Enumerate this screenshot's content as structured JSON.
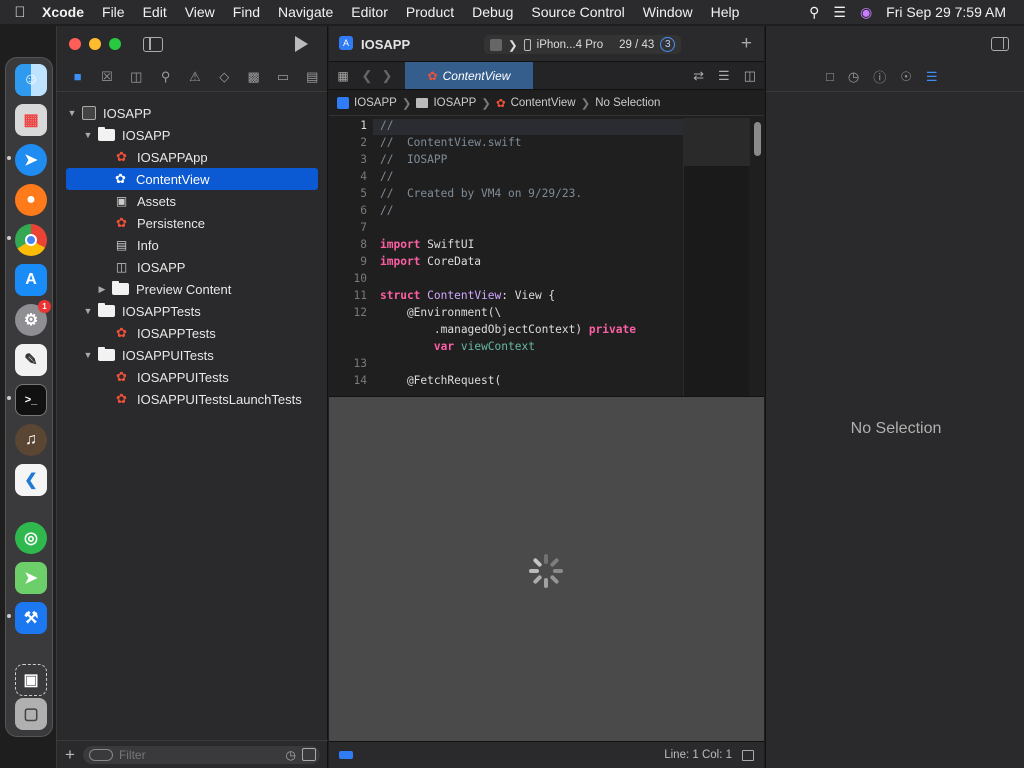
{
  "menubar": {
    "app": "Xcode",
    "items": [
      "File",
      "Edit",
      "View",
      "Find",
      "Navigate",
      "Editor",
      "Product",
      "Debug",
      "Source Control",
      "Window",
      "Help"
    ],
    "datetime": "Fri Sep 29  7:59 AM",
    "icons": [
      "search-icon",
      "control-center-icon",
      "siri-icon"
    ]
  },
  "dock": {
    "items": [
      "finder",
      "launchpad",
      "safari",
      "firefox",
      "chrome",
      "app-store",
      "system-settings",
      "textedit",
      "terminal",
      "instruments",
      "vscode",
      "find-my",
      "maps",
      "xcode",
      "screenshot",
      "trash"
    ],
    "settings_badge": "1"
  },
  "toolbar": {
    "project": "IOSAPP",
    "scheme": "iPhon...4 Pro",
    "count": "29 / 43",
    "issues": "3"
  },
  "navigator": {
    "tree": [
      {
        "label": "IOSAPP",
        "level": 0,
        "icon": "project",
        "disclosure": "open"
      },
      {
        "label": "IOSAPP",
        "level": 1,
        "icon": "folder",
        "disclosure": "open"
      },
      {
        "label": "IOSAPPApp",
        "level": 2,
        "icon": "swift"
      },
      {
        "label": "ContentView",
        "level": 2,
        "icon": "swift",
        "selected": true
      },
      {
        "label": "Assets",
        "level": 2,
        "icon": "assets"
      },
      {
        "label": "Persistence",
        "level": 2,
        "icon": "swift"
      },
      {
        "label": "Info",
        "level": 2,
        "icon": "plist"
      },
      {
        "label": "IOSAPP",
        "level": 2,
        "icon": "datamodel"
      },
      {
        "label": "Preview Content",
        "level": 2,
        "icon": "folder",
        "disclosure": "closed"
      },
      {
        "label": "IOSAPPTests",
        "level": 1,
        "icon": "folder",
        "disclosure": "open"
      },
      {
        "label": "IOSAPPTests",
        "level": 2,
        "icon": "swift"
      },
      {
        "label": "IOSAPPUITests",
        "level": 1,
        "icon": "folder",
        "disclosure": "open"
      },
      {
        "label": "IOSAPPUITests",
        "level": 2,
        "icon": "swift"
      },
      {
        "label": "IOSAPPUITestsLaunchTests",
        "level": 2,
        "icon": "swift"
      }
    ],
    "filter_placeholder": "Filter"
  },
  "editor": {
    "tab": "ContentView",
    "jumpbar": [
      "IOSAPP",
      "IOSAPP",
      "ContentView",
      "No Selection"
    ],
    "code": [
      {
        "n": "1",
        "t": [
          [
            "cm",
            "//"
          ]
        ]
      },
      {
        "n": "2",
        "t": [
          [
            "cm",
            "//  ContentView.swift"
          ]
        ]
      },
      {
        "n": "3",
        "t": [
          [
            "cm",
            "//  IOSAPP"
          ]
        ]
      },
      {
        "n": "4",
        "t": [
          [
            "cm",
            "//"
          ]
        ]
      },
      {
        "n": "5",
        "t": [
          [
            "cm",
            "//  Created by VM4 on 9/29/23."
          ]
        ]
      },
      {
        "n": "6",
        "t": [
          [
            "cm",
            "//"
          ]
        ]
      },
      {
        "n": "7",
        "t": []
      },
      {
        "n": "8",
        "t": [
          [
            "kw",
            "import"
          ],
          [
            "",
            " SwiftUI"
          ]
        ]
      },
      {
        "n": "9",
        "t": [
          [
            "kw",
            "import"
          ],
          [
            "",
            " CoreData"
          ]
        ]
      },
      {
        "n": "10",
        "t": []
      },
      {
        "n": "11",
        "t": [
          [
            "kw",
            "struct"
          ],
          [
            "",
            " "
          ],
          [
            "ty",
            "ContentView"
          ],
          [
            "",
            ": View {"
          ]
        ]
      },
      {
        "n": "12",
        "t": [
          [
            "",
            "    @Environment(\\"
          ]
        ]
      },
      {
        "n": "",
        "t": [
          [
            "",
            "        .managedObjectContext) "
          ],
          [
            "kw",
            "private"
          ]
        ]
      },
      {
        "n": "",
        "t": [
          [
            "",
            "        "
          ],
          [
            "kw",
            "var"
          ],
          [
            "",
            " "
          ],
          [
            "pr",
            "viewContext"
          ]
        ]
      },
      {
        "n": "13",
        "t": []
      },
      {
        "n": "14",
        "t": [
          [
            "",
            "    @FetchRequest("
          ]
        ]
      }
    ],
    "status": "Line: 1  Col: 1"
  },
  "inspector": {
    "empty": "No Selection"
  }
}
